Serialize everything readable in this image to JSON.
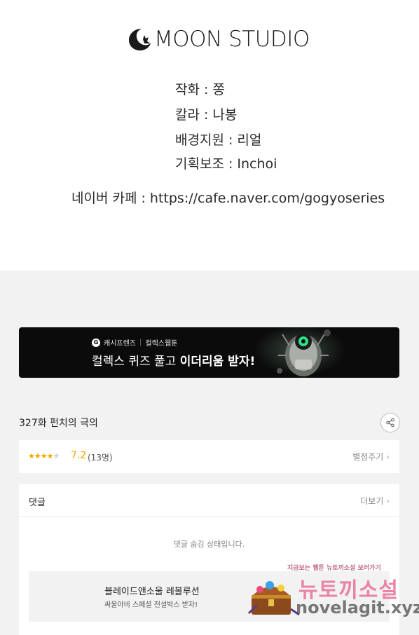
{
  "credits": {
    "logo_text": "MOON STUDIO",
    "lines": [
      "작화 : 쫑",
      "칼라 : 나봉",
      "배경지원 : 리얼",
      "기획보조 : Inchoi"
    ],
    "cafe": "네이버 카페 : https://cafe.naver.com/gogyoseries"
  },
  "banner": {
    "brand": "캐시프렌즈",
    "brand2": "컬렉스웹툰",
    "title_normal": "컬렉스 퀴즈 풀고 ",
    "title_bold": "이더리움 받자!"
  },
  "episode": {
    "title": "327화 펀치의 극의",
    "share_icon": "share-icon"
  },
  "rating": {
    "stars_filled": "★★★★",
    "stars_empty": "★",
    "stars_value": 3.6,
    "score": "7.2",
    "count": "(13명)",
    "rate_link": "별점주기",
    "accent": "#f0a800"
  },
  "comments": {
    "label": "댓글",
    "more": "더보기",
    "hidden_msg": "댓글 숨김 상태입니다."
  },
  "ad": {
    "title": "블레이드앤소울 레볼루션",
    "subtitle": "싸울아비 스페셜 전설박스 받자!"
  },
  "watermark": {
    "top": "지금보는 웹툰 뉴토끼소설 보러가기",
    "big": "뉴토끼소설",
    "url": "novelagit.xyz"
  }
}
